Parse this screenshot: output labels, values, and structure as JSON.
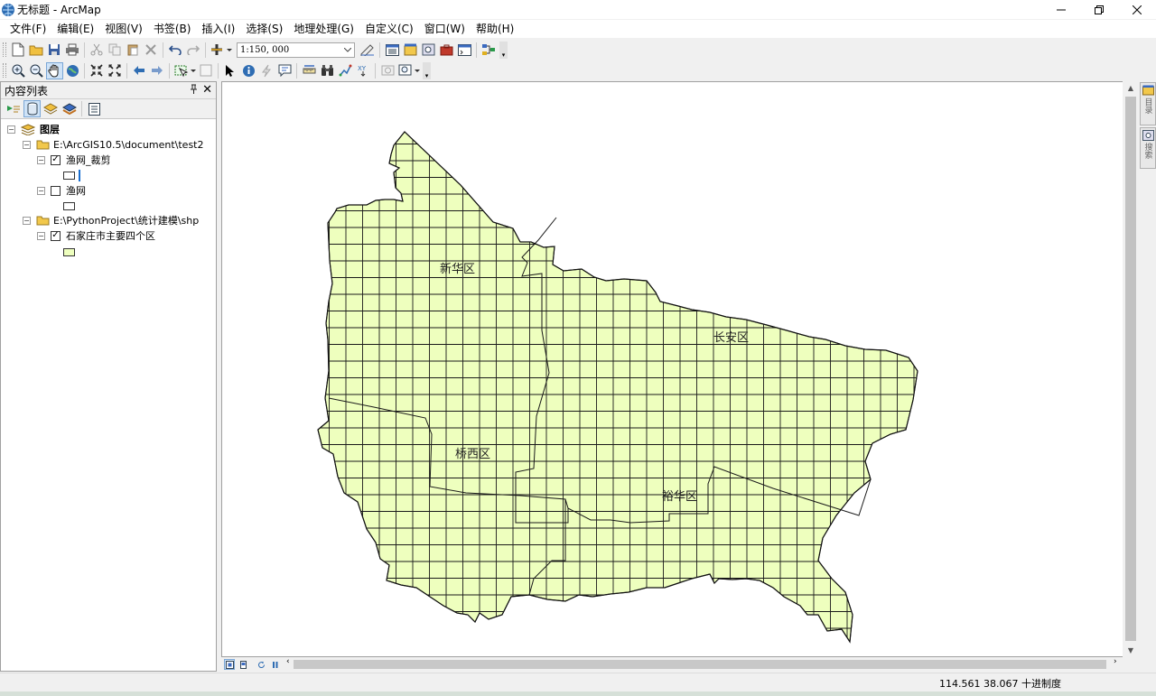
{
  "window": {
    "title": "无标题 - ArcMap",
    "icon": "arcmap-globe-icon",
    "buttons": [
      "minimize-icon",
      "restore-icon",
      "close-icon"
    ]
  },
  "menu": [
    "文件(F)",
    "编辑(E)",
    "视图(V)",
    "书签(B)",
    "插入(I)",
    "选择(S)",
    "地理处理(G)",
    "自定义(C)",
    "窗口(W)",
    "帮助(H)"
  ],
  "toolbar": {
    "scale": "1:150, 000"
  },
  "toc": {
    "title": "内容列表",
    "root": "图层",
    "groups": [
      {
        "path": "E:\\ArcGIS10.5\\document\\test2",
        "layers": [
          {
            "name": "渔网_裁剪",
            "checked": true,
            "symbol": "#ffffff"
          },
          {
            "name": "渔网",
            "checked": false,
            "symbol": "#ffffff"
          }
        ]
      },
      {
        "path": "E:\\PythonProject\\统计建模\\shp",
        "layers": [
          {
            "name": "石家庄市主要四个区",
            "checked": true,
            "symbol": "#eeffbe"
          }
        ]
      }
    ]
  },
  "map": {
    "fill_color": "#eeffbe",
    "line_color": "#1a1a1a",
    "labels": [
      "新华区",
      "长安区",
      "桥西区",
      "裕华区"
    ]
  },
  "side_tabs": [
    "目录",
    "搜索"
  ],
  "status": {
    "coordinates": "114.561  38.067 十进制度"
  }
}
